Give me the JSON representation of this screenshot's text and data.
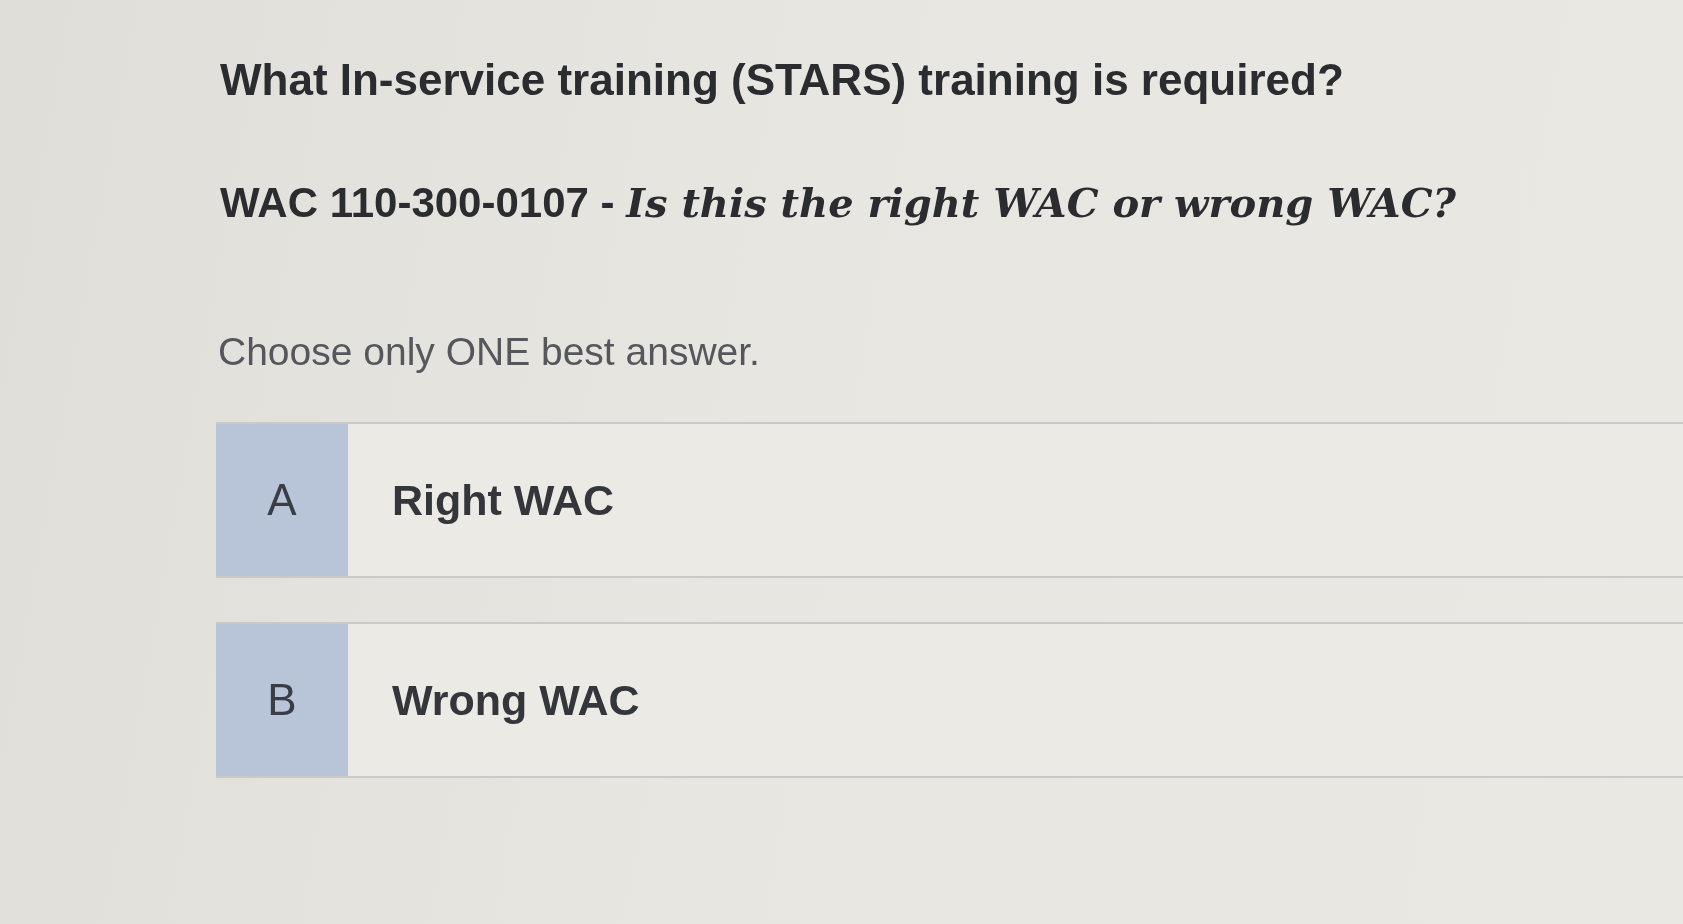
{
  "question": {
    "title": "What In-service training (STARS) training is required?",
    "prompt": "WAC 110-300-0107 - *Is this the right WAC or wrong WAC?*",
    "instruction": "Choose only ONE best answer."
  },
  "options": [
    {
      "letter": "A",
      "label": "Right WAC",
      "selected": false
    },
    {
      "letter": "B",
      "label": "Wrong WAC",
      "selected": false
    }
  ]
}
